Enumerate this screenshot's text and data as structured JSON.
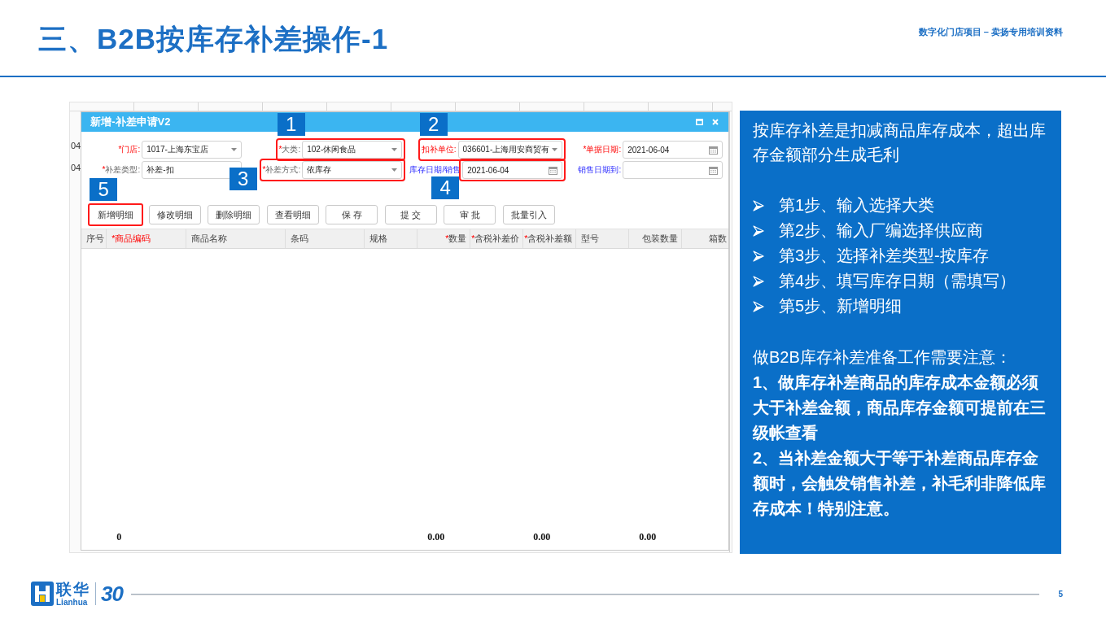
{
  "header": {
    "title": "三、B2B按库存补差操作-1",
    "subtitle": "数字化门店项目 – 卖扬专用培训资料"
  },
  "background_window": {
    "fragments": [
      "04",
      "04"
    ]
  },
  "dialog": {
    "title": "新增-补差申请V2",
    "form_rows": [
      [
        {
          "kind": "select",
          "label": {
            "kind": "required",
            "mark": "*",
            "text": "门店:"
          },
          "value": "1017-上海东宝店",
          "highlighted": false
        },
        {
          "kind": "select",
          "label": {
            "kind": "plain",
            "mark": "*",
            "text": "大类:"
          },
          "value": "102-休闲食品",
          "highlighted": true,
          "frame_includes_label": true,
          "step": "1",
          "badge_above": true
        },
        {
          "kind": "select",
          "label": {
            "kind": "required",
            "text": "扣补单位:"
          },
          "value": "036601-上海用安商贸有",
          "highlighted": true,
          "frame_includes_label": true,
          "step": "2",
          "badge_above": true
        },
        {
          "kind": "date",
          "label": {
            "kind": "required",
            "mark": "*",
            "text": "单据日期:"
          },
          "value": "2021-06-04",
          "highlighted": false
        }
      ],
      [
        {
          "kind": "text",
          "label": {
            "kind": "plain",
            "mark": "*",
            "text": "补差类型:"
          },
          "value": "补差-扣",
          "highlighted": false
        },
        {
          "kind": "select",
          "label": {
            "kind": "plain",
            "mark": "*",
            "text": "补差方式:"
          },
          "value": "依库存",
          "highlighted": true,
          "frame_includes_label": true,
          "step": "3",
          "badge_above": false
        },
        {
          "kind": "date",
          "label": {
            "kind": "range",
            "text": "库存日期/销售"
          },
          "value": "2021-06-04",
          "highlighted": true,
          "frame_includes_label": false,
          "step": "4",
          "badge_above": false
        },
        {
          "kind": "date",
          "label": {
            "kind": "range",
            "text": "销售日期到:"
          },
          "highlighted": false
        }
      ]
    ],
    "buttons": [
      {
        "label": "新增明细",
        "highlighted": true,
        "step": "5",
        "badge_above": true
      },
      {
        "label": "修改明细",
        "highlighted": false
      },
      {
        "label": "删除明细",
        "highlighted": false
      },
      {
        "label": "查看明细",
        "highlighted": false
      },
      {
        "label": "保 存",
        "highlighted": false
      },
      {
        "label": "提 交",
        "highlighted": false
      },
      {
        "label": "审 批",
        "highlighted": false
      },
      {
        "label": "批量引入",
        "highlighted": false
      }
    ],
    "columns": [
      {
        "kind": "text",
        "label": {
          "kind": "plain",
          "text": "序号"
        }
      },
      {
        "kind": "text",
        "label": {
          "kind": "required",
          "mark": "*",
          "text": "商品编码"
        },
        "total": "0"
      },
      {
        "kind": "text",
        "label": {
          "kind": "plain",
          "text": "商品名称"
        }
      },
      {
        "kind": "text",
        "label": {
          "kind": "plain",
          "text": "条码"
        }
      },
      {
        "kind": "text",
        "label": {
          "kind": "plain",
          "text": "规格"
        }
      },
      {
        "kind": "number",
        "label": {
          "kind": "plain",
          "mark": "*",
          "text": "数量"
        },
        "total": "0.00"
      },
      {
        "kind": "number",
        "label": {
          "kind": "plain",
          "mark": "*",
          "text": "含税补差价"
        }
      },
      {
        "kind": "number",
        "label": {
          "kind": "plain",
          "mark": "*",
          "text": "含税补差额"
        },
        "total": "0.00"
      },
      {
        "kind": "text",
        "label": {
          "kind": "plain",
          "text": "型号"
        }
      },
      {
        "kind": "number",
        "label": {
          "kind": "plain",
          "text": "包装数量"
        },
        "total": "0.00"
      },
      {
        "kind": "number",
        "label": {
          "kind": "plain",
          "text": "箱数"
        }
      }
    ]
  },
  "info_panel": {
    "intro": "按库存补差是扣减商品库存成本，超出库存金额部分生成毛利",
    "steps": [
      "第1步、输入选择大类",
      "第2步、输入厂编选择供应商",
      "第3步、选择补差类型-按库存",
      "第4步、填写库存日期（需填写）",
      "第5步、新增明细"
    ],
    "notes_heading": "做B2B库存补差准备工作需要注意：",
    "notes": [
      "1、做库存补差商品的库存成本金额必须大于补差金额，商品库存金额可提前在三级帐查看",
      "2、当补差金额大于等于补差商品库存金额时，会触发销售补差，补毛利非降低库存成本！特别注意。"
    ]
  },
  "footer": {
    "brand": "联华",
    "brand_latin": "Lianhua",
    "anniversary": "30",
    "page_number": "5"
  }
}
